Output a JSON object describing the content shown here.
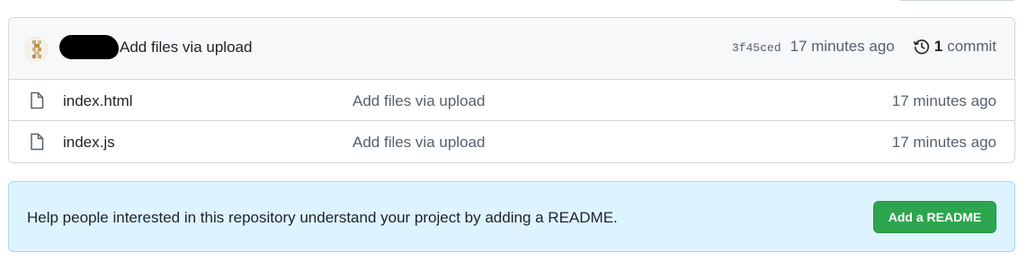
{
  "latest_commit": {
    "message": "Add files via upload",
    "sha": "3f45ced",
    "time_ago": "17 minutes ago",
    "commit_count": "1",
    "commit_word": "commit"
  },
  "files": [
    {
      "name": "index.html",
      "message": "Add files via upload",
      "time_ago": "17 minutes ago",
      "icon": "file-icon"
    },
    {
      "name": "index.js",
      "message": "Add files via upload",
      "time_ago": "17 minutes ago",
      "icon": "file-icon"
    }
  ],
  "readme_prompt": {
    "text": "Help people interested in this repository understand your project by adding a README.",
    "button_label": "Add a README"
  },
  "colors": {
    "accent_green": "#2da44e",
    "info_bg": "#ddf4ff",
    "border": "#d0d7de"
  }
}
